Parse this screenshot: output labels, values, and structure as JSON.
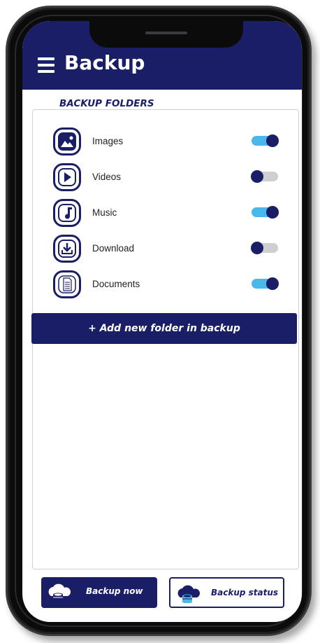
{
  "header": {
    "title": "Backup",
    "menu_icon": "hamburger-menu-icon"
  },
  "section": {
    "label": "BACKUP FOLDERS"
  },
  "folders": [
    {
      "label": "Images",
      "icon": "image-icon",
      "enabled": true
    },
    {
      "label": "Videos",
      "icon": "play-icon",
      "enabled": false
    },
    {
      "label": "Music",
      "icon": "music-note-icon",
      "enabled": true
    },
    {
      "label": "Download",
      "icon": "download-icon",
      "enabled": false
    },
    {
      "label": "Documents",
      "icon": "document-icon",
      "enabled": true
    }
  ],
  "actions": {
    "add_folder": "+ Add new folder in backup",
    "backup_now": "Backup now",
    "backup_status": "Backup status"
  },
  "colors": {
    "primary": "#1a1e66",
    "toggle_on": "#4bb8ea",
    "toggle_off": "#cfcfd2"
  }
}
